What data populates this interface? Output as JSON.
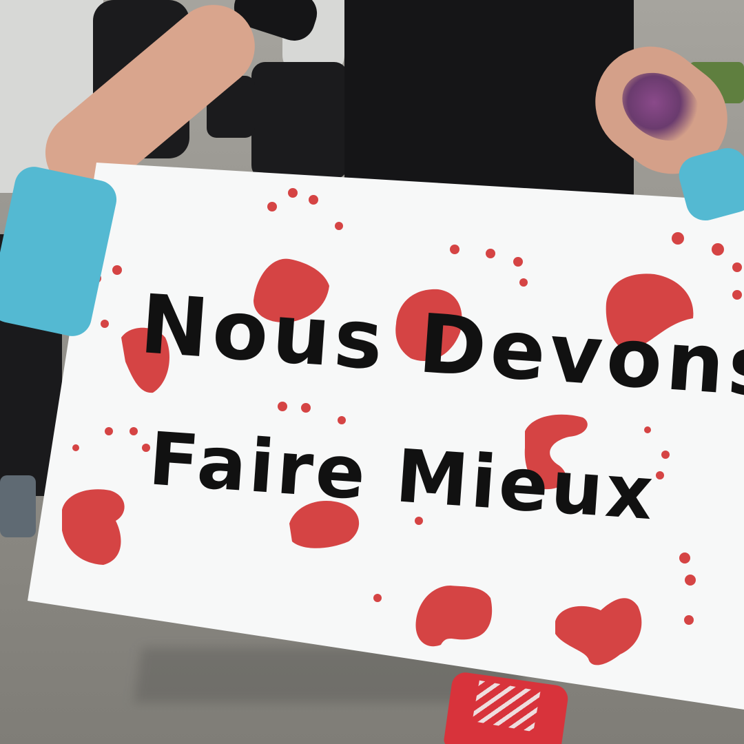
{
  "sign": {
    "line1": "Nous Devons",
    "line2": "Faire Mieux"
  },
  "colors": {
    "board": "#f7f8f8",
    "lettering": "#111111",
    "handprint": "#d02a2a",
    "glove": "#54b9d2",
    "shoe": "#d8333b"
  },
  "icons": {
    "handprints": "handprint-icon"
  }
}
